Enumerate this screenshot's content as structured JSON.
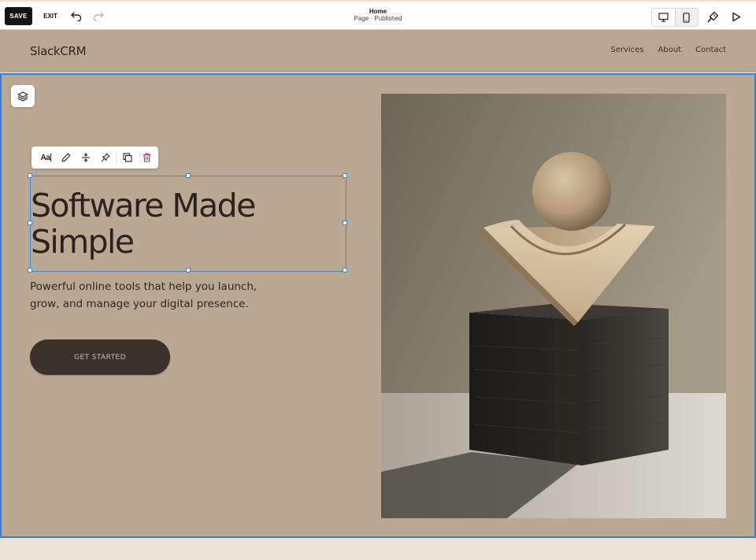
{
  "editor": {
    "save_label": "SAVE",
    "exit_label": "EXIT",
    "page_title": "Home",
    "page_status": "Page · Published",
    "icons": [
      "undo-icon",
      "redo-icon",
      "desktop-icon",
      "mobile-icon",
      "paintbrush-icon",
      "play-icon"
    ]
  },
  "site": {
    "logo": "SlackCRM",
    "nav": [
      "Services",
      "About",
      "Contact"
    ]
  },
  "hero": {
    "heading": "Software Made\nSimple",
    "subheading": "Powerful online tools that help you launch, grow, and manage your digital presence.",
    "cta_label": "GET STARTED"
  },
  "text_toolbar": {
    "font_label": "Aa",
    "icons": [
      "font-style-icon",
      "pencil-icon",
      "spacing-icon",
      "pin-icon",
      "duplicate-icon",
      "trash-icon"
    ]
  },
  "colors": {
    "header_bg": "#b9a793",
    "hero_bg": "#bba893",
    "selection": "#2f7fdc",
    "cta_bg": "#3b302a",
    "delete": "#b0304a"
  }
}
